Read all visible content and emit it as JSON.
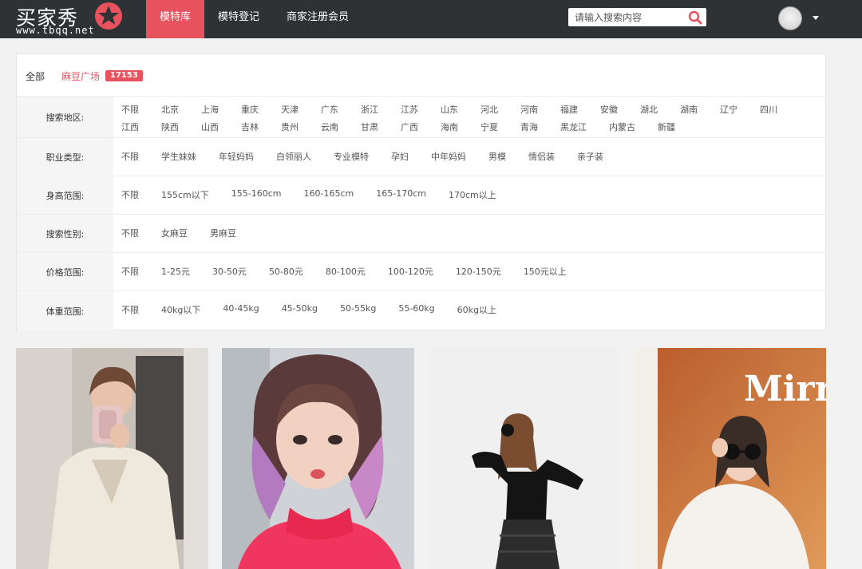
{
  "header": {
    "logo_text": "买家秀",
    "logo_url": "www.tbqq.net",
    "nav": [
      "模特库",
      "模特登记",
      "商家注册会员"
    ],
    "active_nav": 0,
    "search_placeholder": "请输入搜索内容"
  },
  "crumbs": {
    "all_label": "全部",
    "current_label": "麻豆广场",
    "count": "17153"
  },
  "filters": [
    {
      "label": "搜索地区:",
      "options": [
        "不限",
        "北京",
        "上海",
        "重庆",
        "天津",
        "广东",
        "浙江",
        "江苏",
        "山东",
        "河北",
        "河南",
        "福建",
        "安徽",
        "湖北",
        "湖南",
        "辽宁",
        "四川",
        "江西",
        "陕西",
        "山西",
        "吉林",
        "贵州",
        "云南",
        "甘肃",
        "广西",
        "海南",
        "宁夏",
        "青海",
        "黑龙江",
        "内蒙古",
        "新疆"
      ]
    },
    {
      "label": "职业类型:",
      "options": [
        "不限",
        "学生妹妹",
        "年轻妈妈",
        "白领丽人",
        "专业模特",
        "孕妇",
        "中年妈妈",
        "男模",
        "情侣装",
        "亲子装"
      ]
    },
    {
      "label": "身高范围:",
      "options": [
        "不限",
        "155cm以下",
        "155-160cm",
        "160-165cm",
        "165-170cm",
        "170cm以上"
      ]
    },
    {
      "label": "搜索性别:",
      "options": [
        "不限",
        "女麻豆",
        "男麻豆"
      ]
    },
    {
      "label": "价格范围:",
      "options": [
        "不限",
        "1-25元",
        "30-50元",
        "50-80元",
        "80-100元",
        "100-120元",
        "120-150元",
        "150元以上"
      ]
    },
    {
      "label": "体重范围:",
      "options": [
        "不限",
        "40kg以下",
        "40-45kg",
        "45-50kg",
        "50-55kg",
        "55-60kg",
        "60kg以上"
      ]
    }
  ],
  "photos": [
    {
      "caption": ""
    },
    {
      "caption": ""
    },
    {
      "caption": ""
    },
    {
      "caption": "Mirr"
    }
  ],
  "colors": {
    "accent": "#e8515e",
    "topbar": "#2f3234"
  }
}
